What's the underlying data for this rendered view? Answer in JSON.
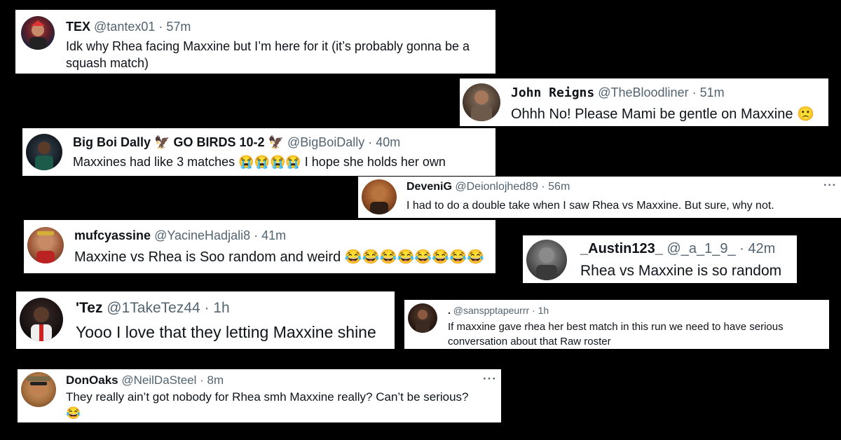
{
  "tweets": [
    {
      "name": "TEX",
      "handle": "@tantex01 · 57m",
      "text1": "Idk why Rhea facing Maxxine but I’m here for it (it’s probably gonna be a",
      "text2": "squash match)"
    },
    {
      "name": "John Reigns",
      "handle": "@TheBloodliner · 51m",
      "text1": "Ohhh No! Please Mami be gentle on Maxxine",
      "emoji": "🙁"
    },
    {
      "name": "Big Boi Dally",
      "name_suffix": "GO BIRDS 10-2",
      "bird": "🦅",
      "handle": "@BigBoiDally · 40m",
      "text_pre": "Maxxines had like 3 matches",
      "emojis": "😭😭😭😭",
      "text_post": "I hope she holds her own"
    },
    {
      "name": "DeveniG",
      "handle": "@Deionlojhed89 · 56m",
      "text1": "I had to do a double take when I saw Rhea vs Maxxine. But sure, why not.",
      "more": "···"
    },
    {
      "name": "mufcyassine",
      "handle": "@YacineHadjali8 · 41m",
      "text1": "Maxxine vs Rhea is Soo random and weird",
      "emojis": "😂😂😂😂😂😂😂😂"
    },
    {
      "name": "_Austin123_",
      "handle": "@_a_1_9_ · 42m",
      "text1": "Rhea vs Maxxine is so random"
    },
    {
      "name": "'Tez",
      "handle": "@1TakeTez44 · 1h",
      "text1": "Yooo I love that they letting Maxxine shine"
    },
    {
      "name": ".",
      "handle": "@sanspptapeurrr · 1h",
      "text1": "If maxxine gave rhea her best match in this run we need to have serious",
      "text2": "conversation about that Raw roster"
    },
    {
      "name": "DonOaks",
      "handle": "@NeilDaSteel · 8m",
      "text1": "They really ain’t got nobody for Rhea smh Maxxine really? Can’t be serious?",
      "emoji": "😂",
      "more": "···"
    }
  ],
  "colors": {
    "background": "#000000",
    "card": "#ffffff",
    "handle": "#536471",
    "text": "#0f1419"
  }
}
